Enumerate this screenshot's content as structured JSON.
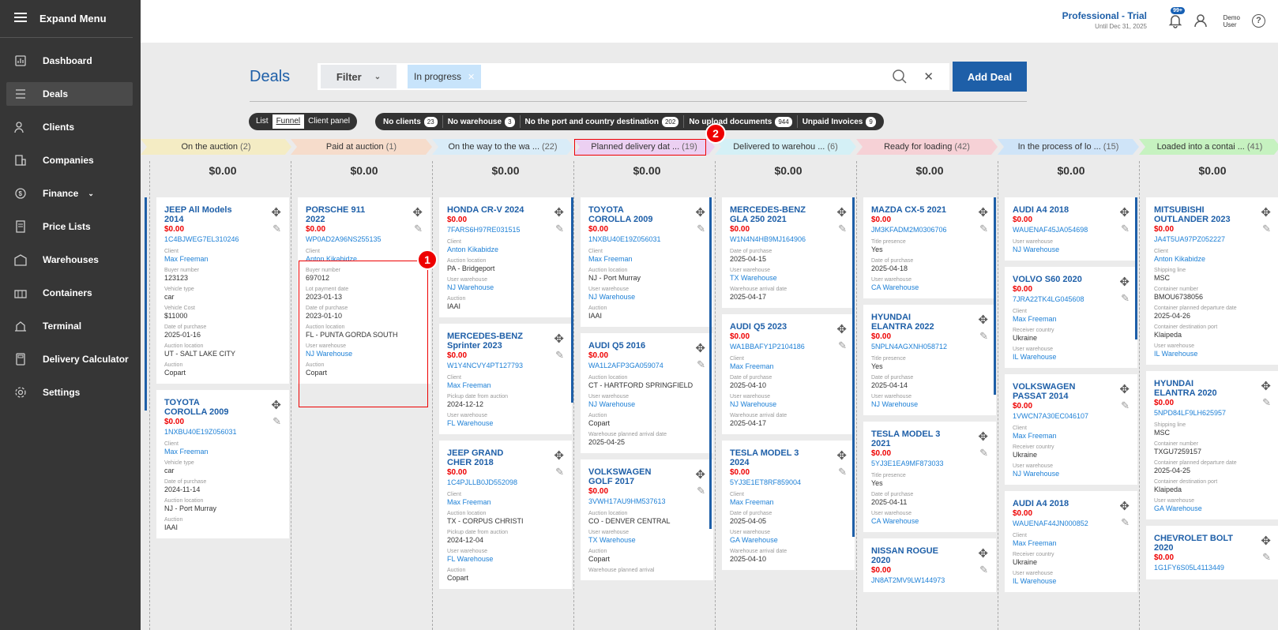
{
  "sidebar": {
    "expand": "Expand Menu",
    "items": [
      {
        "label": "Dashboard",
        "icon": "dashboard-icon"
      },
      {
        "label": "Deals",
        "icon": "deals-icon",
        "active": true
      },
      {
        "label": "Clients",
        "icon": "clients-icon"
      },
      {
        "label": "Companies",
        "icon": "companies-icon"
      },
      {
        "label": "Finance",
        "icon": "finance-icon",
        "chevron": true
      },
      {
        "label": "Price Lists",
        "icon": "price-lists-icon"
      },
      {
        "label": "Warehouses",
        "icon": "warehouses-icon"
      },
      {
        "label": "Containers",
        "icon": "containers-icon"
      },
      {
        "label": "Terminal",
        "icon": "terminal-icon"
      },
      {
        "label": "Delivery Calculator",
        "icon": "calculator-icon"
      },
      {
        "label": "Settings",
        "icon": "settings-icon"
      }
    ]
  },
  "header": {
    "plan": "Professional - Trial",
    "plan_until": "Until Dec 31, 2025",
    "notif_count": "99+",
    "user_first": "Demo",
    "user_last": "User",
    "help": "?"
  },
  "page": {
    "title": "Deals",
    "filter_label": "Filter",
    "chip": "In progress",
    "add_deal": "Add Deal"
  },
  "view_toggles": [
    "List",
    "Funnel",
    "Client panel"
  ],
  "quick_filters": [
    {
      "label": "No clients",
      "count": "23"
    },
    {
      "label": "No warehouse",
      "count": "3"
    },
    {
      "label": "No the port and country destination",
      "count": "202"
    },
    {
      "label": "No upload documents",
      "count": "944"
    },
    {
      "label": "Unpaid Invoices",
      "count": "9"
    }
  ],
  "stages": [
    {
      "name": "On the auction",
      "count": "(2)",
      "color": "#f4ecc4"
    },
    {
      "name": "Paid at auction",
      "count": "(1)",
      "color": "#f6dccb"
    },
    {
      "name": "On the way to the wa ...",
      "count": "(22)",
      "color": "#d9ecf8"
    },
    {
      "name": "Planned delivery dat ...",
      "count": "(19)",
      "color": "#ecd0f2"
    },
    {
      "name": "Delivered to warehou ...",
      "count": "(6)",
      "color": "#d4f0f6"
    },
    {
      "name": "Ready for loading",
      "count": "(42)",
      "color": "#f6d1d6"
    },
    {
      "name": "In the process of lo ...",
      "count": "(15)",
      "color": "#cfe4f8"
    },
    {
      "name": "Loaded into a contai ...",
      "count": "(41)",
      "color": "#c6f2c0"
    }
  ],
  "columns": [
    {
      "sum": "$0.00",
      "cards": [
        {
          "name": "JEEP All Models 2014",
          "price": "$0.00",
          "vin": "1C4BJWEG7EL310246",
          "fields": [
            [
              "Client",
              "Max Freeman",
              1
            ],
            [
              "Buyer number",
              "123123",
              0
            ],
            [
              "Vehicle type",
              "car",
              0
            ],
            [
              "Vehicle Cost",
              "$11000",
              0
            ],
            [
              "Date of purchase",
              "2025-01-16",
              0
            ],
            [
              "Auction location",
              "UT - SALT LAKE CITY",
              0
            ],
            [
              "Auction",
              "Copart",
              0
            ]
          ]
        },
        {
          "name": "TOYOTA COROLLA 2009",
          "price": "$0.00",
          "vin": "1NXBU40E19Z056031",
          "fields": [
            [
              "Client",
              "Max Freeman",
              1
            ],
            [
              "Vehicle type",
              "car",
              0
            ],
            [
              "Date of purchase",
              "2024-11-14",
              0
            ],
            [
              "Auction location",
              "NJ - Port Murray",
              0
            ],
            [
              "Auction",
              "IAAI",
              0
            ]
          ]
        }
      ]
    },
    {
      "sum": "$0.00",
      "cards": [
        {
          "name": "PORSCHE 911 2022",
          "price": "$0.00",
          "vin": "WP0AD2A96NS255135",
          "fields": [
            [
              "Client",
              "Anton Kikabidze",
              1
            ],
            [
              "Buyer number",
              "697012",
              0
            ],
            [
              "Lot payment date",
              "2023-01-13",
              0
            ],
            [
              "Date of purchase",
              "2023-01-10",
              0
            ],
            [
              "Auction location",
              "FL - PUNTA GORDA SOUTH",
              0
            ],
            [
              "User warehouse",
              "NJ Warehouse",
              1
            ],
            [
              "Auction",
              "Copart",
              0
            ]
          ]
        }
      ]
    },
    {
      "sum": "$0.00",
      "cards": [
        {
          "name": "HONDA CR-V 2024",
          "price": "$0.00",
          "vin": "7FARS6H97RE031515",
          "fields": [
            [
              "Client",
              "Anton Kikabidze",
              1
            ],
            [
              "Auction location",
              "PA - Bridgeport",
              0
            ],
            [
              "User warehouse",
              "NJ Warehouse",
              1
            ],
            [
              "Auction",
              "IAAI",
              0
            ]
          ]
        },
        {
          "name": "MERCEDES-BENZ Sprinter 2023",
          "price": "$0.00",
          "vin": "W1Y4NCVY4PT127793",
          "fields": [
            [
              "Client",
              "Max Freeman",
              1
            ],
            [
              "Pickup date from auction",
              "2024-12-12",
              0
            ],
            [
              "User warehouse",
              "FL Warehouse",
              1
            ]
          ]
        },
        {
          "name": "JEEP GRAND CHER 2018",
          "price": "$0.00",
          "vin": "1C4PJLLB0JD552098",
          "fields": [
            [
              "Client",
              "Max Freeman",
              1
            ],
            [
              "Auction location",
              "TX - CORPUS CHRISTI",
              0
            ],
            [
              "Pickup date from auction",
              "2024-12-04",
              0
            ],
            [
              "User warehouse",
              "FL Warehouse",
              1
            ],
            [
              "Auction",
              "Copart",
              0
            ]
          ]
        }
      ]
    },
    {
      "sum": "$0.00",
      "cards": [
        {
          "name": "TOYOTA COROLLA 2009",
          "price": "$0.00",
          "vin": "1NXBU40E19Z056031",
          "fields": [
            [
              "Client",
              "Max Freeman",
              1
            ],
            [
              "Auction location",
              "NJ - Port Murray",
              0
            ],
            [
              "User warehouse",
              "NJ Warehouse",
              1
            ],
            [
              "Auction",
              "IAAI",
              0
            ]
          ]
        },
        {
          "name": "AUDI Q5 2016",
          "price": "$0.00",
          "vin": "WA1L2AFP3GA059074",
          "fields": [
            [
              "Auction location",
              "CT - HARTFORD SPRINGFIELD",
              0
            ],
            [
              "User warehouse",
              "NJ Warehouse",
              1
            ],
            [
              "Auction",
              "Copart",
              0
            ],
            [
              "Warehouse planned arrival date",
              "2025-04-25",
              0
            ]
          ]
        },
        {
          "name": "VOLKSWAGEN GOLF 2017",
          "price": "$0.00",
          "vin": "3VWH17AU9HM537613",
          "fields": [
            [
              "Auction location",
              "CO - DENVER CENTRAL",
              0
            ],
            [
              "User warehouse",
              "TX Warehouse",
              1
            ],
            [
              "Auction",
              "Copart",
              0
            ],
            [
              "Warehouse planned arrival",
              "",
              0
            ]
          ]
        }
      ]
    },
    {
      "sum": "$0.00",
      "cards": [
        {
          "name": "MERCEDES-BENZ GLA 250 2021",
          "price": "$0.00",
          "vin": "W1N4N4HB9MJ164906",
          "fields": [
            [
              "Date of purchase",
              "2025-04-15",
              0
            ],
            [
              "User warehouse",
              "TX Warehouse",
              1
            ],
            [
              "Warehouse arrival date",
              "2025-04-17",
              0
            ]
          ]
        },
        {
          "name": "AUDI Q5 2023",
          "price": "$0.00",
          "vin": "WA1BBAFY1P2104186",
          "fields": [
            [
              "Client",
              "Max Freeman",
              1
            ],
            [
              "Date of purchase",
              "2025-04-10",
              0
            ],
            [
              "User warehouse",
              "NJ Warehouse",
              1
            ],
            [
              "Warehouse arrival date",
              "2025-04-17",
              0
            ]
          ]
        },
        {
          "name": "TESLA MODEL 3 2024",
          "price": "$0.00",
          "vin": "5YJ3E1ET8RF859004",
          "fields": [
            [
              "Client",
              "Max Freeman",
              1
            ],
            [
              "Date of purchase",
              "2025-04-05",
              0
            ],
            [
              "User warehouse",
              "GA Warehouse",
              1
            ],
            [
              "Warehouse arrival date",
              "2025-04-10",
              0
            ]
          ]
        }
      ]
    },
    {
      "sum": "$0.00",
      "cards": [
        {
          "name": "MAZDA CX-5 2021",
          "price": "$0.00",
          "vin": "JM3KFADM2M0306706",
          "fields": [
            [
              "Title presence",
              "Yes",
              0
            ],
            [
              "Date of purchase",
              "2025-04-18",
              0
            ],
            [
              "User warehouse",
              "CA Warehouse",
              1
            ]
          ]
        },
        {
          "name": "HYUNDAI ELANTRA 2022",
          "price": "$0.00",
          "vin": "5NPLN4AGXNH058712",
          "fields": [
            [
              "Title presence",
              "Yes",
              0
            ],
            [
              "Date of purchase",
              "2025-04-14",
              0
            ],
            [
              "User warehouse",
              "NJ Warehouse",
              1
            ]
          ]
        },
        {
          "name": "TESLA MODEL 3 2021",
          "price": "$0.00",
          "vin": "5YJ3E1EA9MF873033",
          "fields": [
            [
              "Title presence",
              "Yes",
              0
            ],
            [
              "Date of purchase",
              "2025-04-11",
              0
            ],
            [
              "User warehouse",
              "CA Warehouse",
              1
            ]
          ]
        },
        {
          "name": "NISSAN ROGUE 2020",
          "price": "$0.00",
          "vin": "JN8AT2MV9LW144973",
          "fields": []
        }
      ]
    },
    {
      "sum": "$0.00",
      "cards": [
        {
          "name": "AUDI A4 2018",
          "price": "$0.00",
          "vin": "WAUENAF45JA054698",
          "fields": [
            [
              "User warehouse",
              "NJ Warehouse",
              1
            ]
          ]
        },
        {
          "name": "VOLVO S60 2020",
          "price": "$0.00",
          "vin": "7JRA22TK4LG045608",
          "fields": [
            [
              "Client",
              "Max Freeman",
              1
            ],
            [
              "Receiver country",
              "Ukraine",
              0
            ],
            [
              "User warehouse",
              "IL Warehouse",
              1
            ]
          ]
        },
        {
          "name": "VOLKSWAGEN PASSAT 2014",
          "price": "$0.00",
          "vin": "1VWCN7A30EC046107",
          "fields": [
            [
              "Client",
              "Max Freeman",
              1
            ],
            [
              "Receiver country",
              "Ukraine",
              0
            ],
            [
              "User warehouse",
              "NJ Warehouse",
              1
            ]
          ]
        },
        {
          "name": "AUDI A4 2018",
          "price": "$0.00",
          "vin": "WAUENAF44JN000852",
          "fields": [
            [
              "Client",
              "Max Freeman",
              1
            ],
            [
              "Receiver country",
              "Ukraine",
              0
            ],
            [
              "User warehouse",
              "IL Warehouse",
              1
            ]
          ]
        }
      ]
    },
    {
      "sum": "$0.00",
      "cards": [
        {
          "name": "MITSUBISHI OUTLANDER 2023",
          "price": "$0.00",
          "vin": "JA4T5UA97PZ052227",
          "fields": [
            [
              "Client",
              "Anton Kikabidze",
              1
            ],
            [
              "Shipping line",
              "MSC",
              0
            ],
            [
              "Container number",
              "BMOU6738056",
              0
            ],
            [
              "Container planned departure date",
              "2025-04-26",
              0
            ],
            [
              "Container destination port",
              "Klaipeda",
              0
            ],
            [
              "User warehouse",
              "IL Warehouse",
              1
            ]
          ]
        },
        {
          "name": "HYUNDAI ELANTRA 2020",
          "price": "$0.00",
          "vin": "5NPD84LF9LH625957",
          "fields": [
            [
              "Shipping line",
              "MSC",
              0
            ],
            [
              "Container number",
              "TXGU7259157",
              0
            ],
            [
              "Container planned departure date",
              "2025-04-25",
              0
            ],
            [
              "Container destination port",
              "Klaipeda",
              0
            ],
            [
              "User warehouse",
              "GA Warehouse",
              1
            ]
          ]
        },
        {
          "name": "CHEVROLET BOLT 2020",
          "price": "$0.00",
          "vin": "1G1FY6S05L4113449",
          "fields": []
        }
      ]
    }
  ],
  "annotations": [
    "1",
    "2"
  ]
}
